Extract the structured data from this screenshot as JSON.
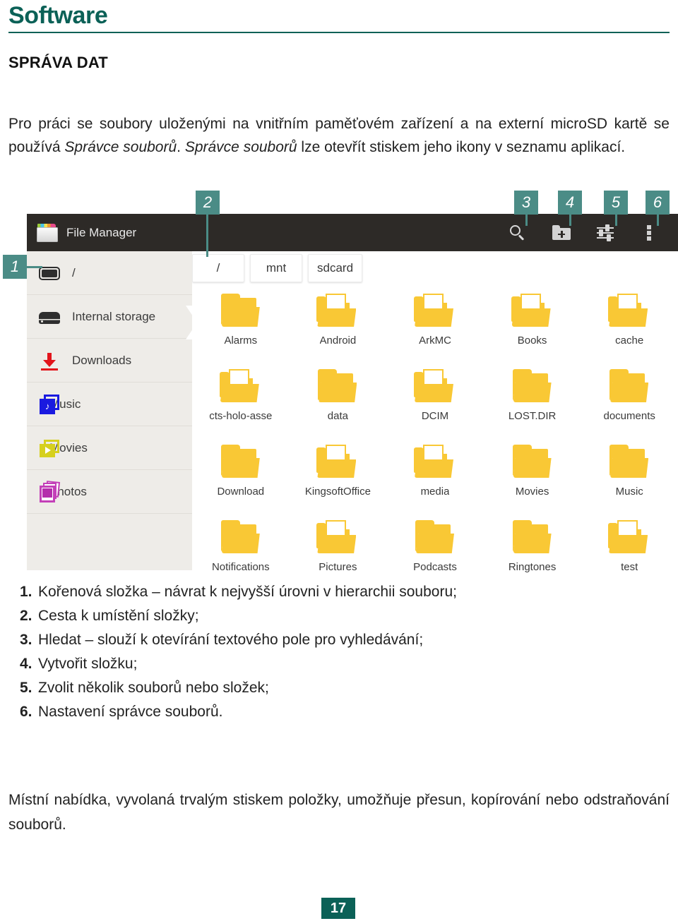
{
  "document": {
    "title": "Software",
    "section_heading": "SPRÁVA DAT",
    "intro_part1": "Pro práci se soubory uloženými na vnitřním paměťovém zařízení a na externí microSD kartě se používá ",
    "intro_italic1": "Správce souborů",
    "intro_part2": ". ",
    "intro_italic2": "Správce souborů",
    "intro_part3": " lze otevřít stiskem jeho ikony v seznamu aplikací.",
    "outro": "Místní nabídka, vyvolaná trvalým stiskem položky, umožňuje přesun, kopírování nebo odstraňování souborů.",
    "page_number": "17",
    "accent_color": "#0b6157",
    "callout_color": "#4b8c86"
  },
  "callouts": [
    {
      "id": "1",
      "label": "1"
    },
    {
      "id": "2",
      "label": "2"
    },
    {
      "id": "3",
      "label": "3"
    },
    {
      "id": "4",
      "label": "4"
    },
    {
      "id": "5",
      "label": "5"
    },
    {
      "id": "6",
      "label": "6"
    }
  ],
  "legend": [
    {
      "n": "1.",
      "text": "Kořenová složka – návrat k nejvyšší úrovni v hierarchii souboru;"
    },
    {
      "n": "2.",
      "text": "Cesta k umístění složky;"
    },
    {
      "n": "3.",
      "text": "Hledat – slouží k otevírání textového pole pro vyhledávání;"
    },
    {
      "n": "4.",
      "text": "Vytvořit složku;"
    },
    {
      "n": "5.",
      "text": "Zvolit několik souborů nebo složek;"
    },
    {
      "n": "6.",
      "text": "Nastavení správce souborů."
    }
  ],
  "screenshot": {
    "appbar": {
      "app_name": "File Manager",
      "app_icon": "file-manager-folder-icon",
      "actions": [
        {
          "icon": "search-icon",
          "name": "search"
        },
        {
          "icon": "new-folder-icon",
          "name": "create-folder"
        },
        {
          "icon": "sliders-icon",
          "name": "select-multiple"
        },
        {
          "icon": "overflow-menu-icon",
          "name": "settings"
        }
      ]
    },
    "drawer": {
      "items": [
        {
          "label": "/",
          "icon": "root-device-icon"
        },
        {
          "label": "Internal storage",
          "icon": "internal-drive-icon"
        },
        {
          "label": "Downloads",
          "icon": "download-arrow-icon"
        },
        {
          "label": "Music",
          "icon": "music-stack-icon"
        },
        {
          "label": "Movies",
          "icon": "movies-stack-icon"
        },
        {
          "label": "Photos",
          "icon": "photos-stack-icon"
        }
      ]
    },
    "breadcrumbs": [
      "/",
      "mnt",
      "sdcard"
    ],
    "files": [
      {
        "name": "Alarms",
        "style": "plain"
      },
      {
        "name": "Android",
        "style": "doc"
      },
      {
        "name": "ArkMC",
        "style": "doc"
      },
      {
        "name": "Books",
        "style": "doc"
      },
      {
        "name": "cache",
        "style": "doc"
      },
      {
        "name": "cts-holo-asse",
        "style": "doc"
      },
      {
        "name": "data",
        "style": "plain"
      },
      {
        "name": "DCIM",
        "style": "doc"
      },
      {
        "name": "LOST.DIR",
        "style": "plain"
      },
      {
        "name": "documents",
        "style": "plain"
      },
      {
        "name": "Download",
        "style": "plain"
      },
      {
        "name": "KingsoftOffice",
        "style": "doc"
      },
      {
        "name": "media",
        "style": "doc"
      },
      {
        "name": "Movies",
        "style": "plain"
      },
      {
        "name": "Music",
        "style": "plain"
      },
      {
        "name": "Notifications",
        "style": "plain"
      },
      {
        "name": "Pictures",
        "style": "doc"
      },
      {
        "name": "Podcasts",
        "style": "plain"
      },
      {
        "name": "Ringtones",
        "style": "plain"
      },
      {
        "name": "test",
        "style": "doc"
      }
    ]
  }
}
